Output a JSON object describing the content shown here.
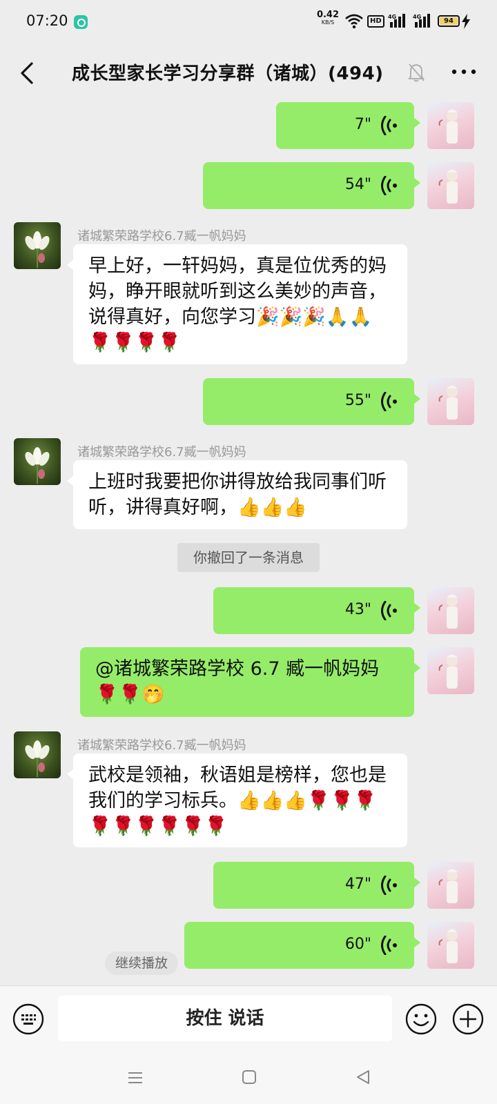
{
  "status_bar": {
    "time": "07:20",
    "net_speed": "0.42",
    "net_speed_unit": "KB/S",
    "hd_badge": "HD",
    "signal_1": "4G",
    "signal_2": "4G",
    "battery": "94"
  },
  "header": {
    "title": "成长型家长学习分享群（诸城）(494)"
  },
  "messages": [
    {
      "type": "voice",
      "side": "self",
      "duration": "7\""
    },
    {
      "type": "voice",
      "side": "self",
      "duration": "54\""
    },
    {
      "type": "text",
      "side": "other",
      "sender": "诸城繁荣路学校6.7臧一帆妈妈",
      "text": "早上好，一轩妈妈，真是位优秀的妈妈，睁开眼就听到这么美妙的声音，说得真好，向您学习🎉🎉🎉🙏🙏🌹🌹🌹🌹"
    },
    {
      "type": "voice",
      "side": "self",
      "duration": "55\""
    },
    {
      "type": "text",
      "side": "other",
      "sender": "诸城繁荣路学校6.7臧一帆妈妈",
      "text": "上班时我要把你讲得放给我同事们听听，讲得真好啊，👍👍👍"
    },
    {
      "type": "system",
      "text": "你撤回了一条消息"
    },
    {
      "type": "voice",
      "side": "self",
      "duration": "43\""
    },
    {
      "type": "text",
      "side": "self",
      "text": "@诸城繁荣路学校 6.7 臧一帆妈妈 🌹🌹🤭"
    },
    {
      "type": "text",
      "side": "other",
      "sender": "诸城繁荣路学校6.7臧一帆妈妈",
      "text": "武校是领袖，秋语姐是榜样，您也是我们的学习标兵。👍👍👍🌹🌹🌹🌹🌹🌹🌹🌹🌹"
    },
    {
      "type": "voice",
      "side": "self",
      "duration": "47\""
    },
    {
      "type": "voice",
      "side": "self",
      "duration": "60\"",
      "hint": "继续播放"
    }
  ],
  "input_bar": {
    "hold_to_talk": "按住 说话"
  },
  "icons": {
    "back": "back-arrow-icon",
    "mute": "bell-off-icon",
    "more": "more-dots-icon",
    "voice": "voice-wave-icon",
    "keyboard": "keyboard-icon",
    "emoji": "emoji-icon",
    "plus": "plus-icon"
  },
  "colors": {
    "self_bubble": "#95ec69",
    "other_bubble": "#ffffff",
    "background": "#ededed"
  }
}
